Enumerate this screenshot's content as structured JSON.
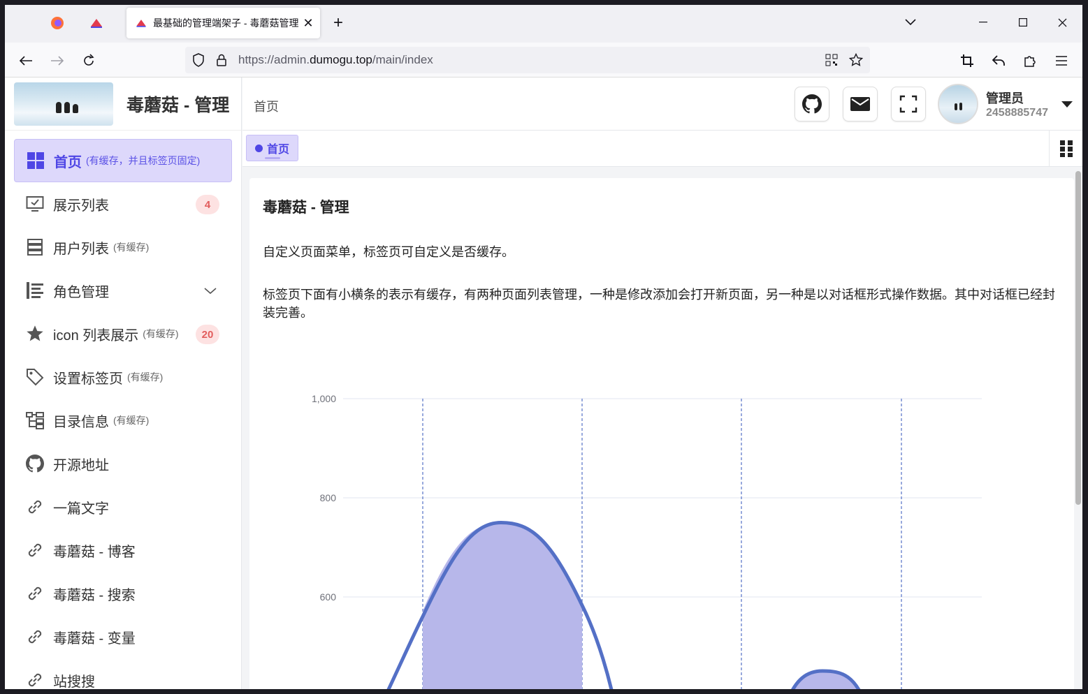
{
  "browser": {
    "active_tab_title": "最基础的管理端架子 - 毒蘑菇管理",
    "url_scheme": "https://admin.",
    "url_host": "dumogu.top",
    "url_path": "/main/index"
  },
  "brand": {
    "name": "毒蘑菇 - 管理"
  },
  "header": {
    "breadcrumb": "首页",
    "user_name": "管理员",
    "user_id": "2458885747"
  },
  "tags": [
    {
      "label": "首页"
    }
  ],
  "menu": [
    {
      "label": "首页",
      "hint": "(有缓存，并且标签页固定)",
      "icon": "dashboard-icon",
      "active": true
    },
    {
      "label": "展示列表",
      "hint": "",
      "icon": "monitor-check-icon",
      "badge": "4"
    },
    {
      "label": "用户列表",
      "hint": "(有缓存)",
      "icon": "server-list-icon"
    },
    {
      "label": "角色管理",
      "hint": "",
      "icon": "list-bars-icon",
      "expandable": true
    },
    {
      "label": "icon 列表展示",
      "hint": "(有缓存)",
      "icon": "star-icon",
      "badge": "20"
    },
    {
      "label": "设置标签页",
      "hint": "(有缓存)",
      "icon": "tag-icon"
    },
    {
      "label": "目录信息",
      "hint": "(有缓存)",
      "icon": "tree-icon"
    },
    {
      "label": "开源地址",
      "hint": "",
      "icon": "github-icon"
    },
    {
      "label": "一篇文字",
      "hint": "",
      "icon": "link-icon"
    },
    {
      "label": "毒蘑菇 - 博客",
      "hint": "",
      "icon": "link-icon"
    },
    {
      "label": "毒蘑菇 - 搜索",
      "hint": "",
      "icon": "link-icon"
    },
    {
      "label": "毒蘑菇 - 变量",
      "hint": "",
      "icon": "link-icon"
    },
    {
      "label": "站搜搜",
      "hint": "",
      "icon": "link-icon"
    }
  ],
  "content": {
    "title": "毒蘑菇 - 管理",
    "p1": "自定义页面菜单，标签页可自定义是否缓存。",
    "p2": "标签页下面有小横条的表示有缓存，有两种页面列表管理，一种是修改添加会打开新页面，另一种是以对话框形式操作数据。其中对话框已经封装完善。"
  },
  "chart_data": {
    "type": "area",
    "y_ticks": [
      "1,000",
      "800",
      "600"
    ],
    "ylim": [
      0,
      1000
    ],
    "peaks": [
      750,
      400
    ],
    "colors": {
      "line": "#5470c6",
      "fill": "#b7b7ea",
      "marker": "#5470c6"
    }
  },
  "colors": {
    "accent": "#4f46e5",
    "active_bg": "#ddd8fb",
    "badge_bg": "#fde2e2",
    "badge_fg": "#e25c5c"
  }
}
